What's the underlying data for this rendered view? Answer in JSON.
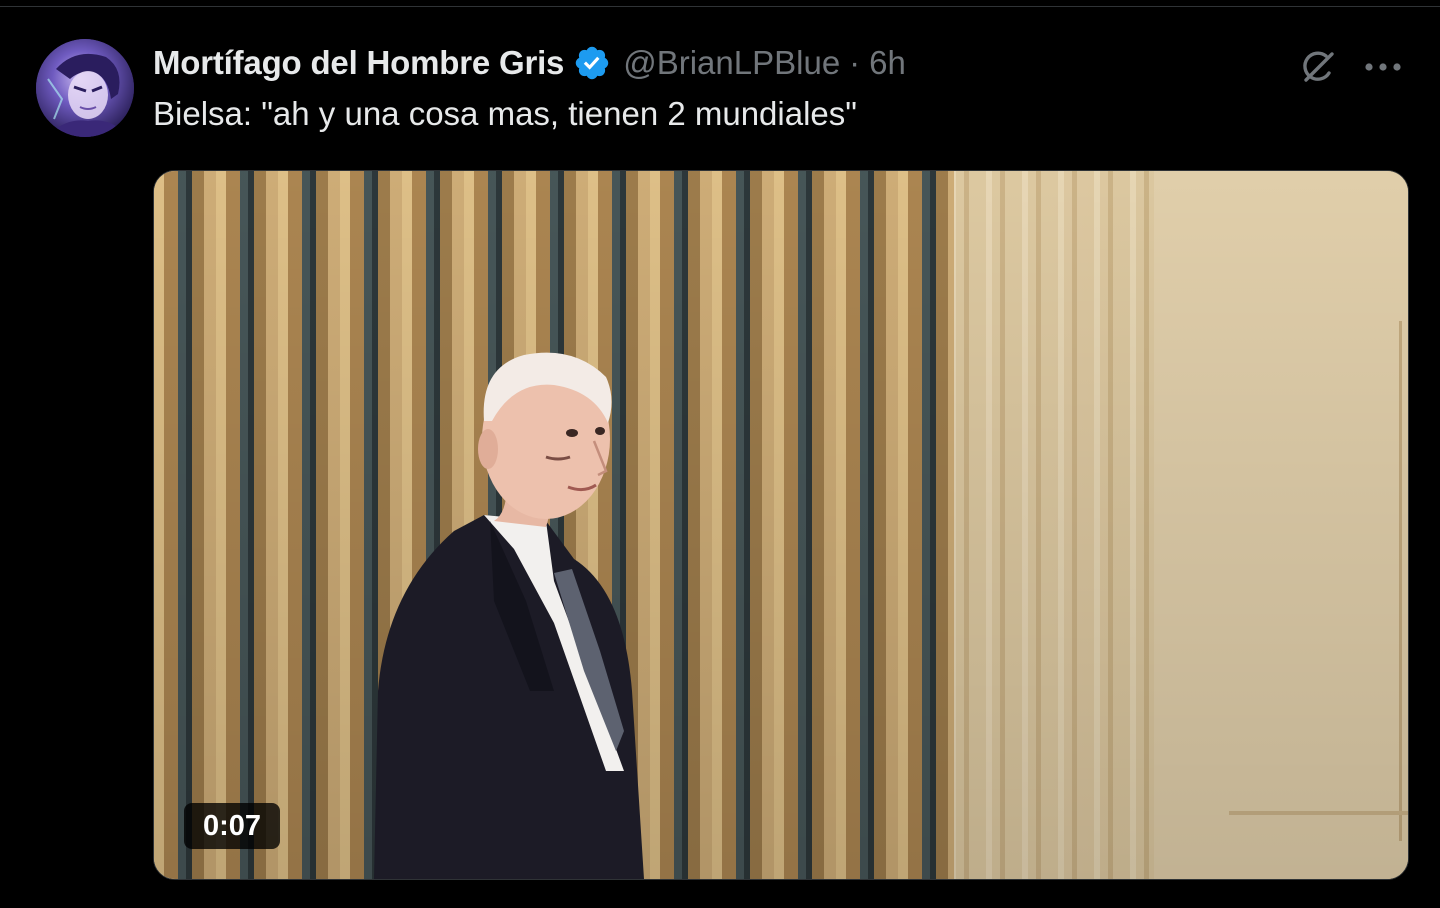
{
  "tweet": {
    "display_name": "Mortífago del Hombre Gris",
    "verified": true,
    "handle": "@BrianLPBlue",
    "separator": "·",
    "time": "6h",
    "text": "Bielsa: \"ah y una cosa mas, tienen 2 mundiales\"",
    "media": {
      "type": "video",
      "duration": "0:07"
    }
  },
  "icons": {
    "verified": "verified-badge-icon",
    "grok": "grok-icon",
    "more": "more-horizontal-icon"
  },
  "colors": {
    "background": "#000000",
    "text_primary": "#e7e9ea",
    "text_secondary": "#71767b",
    "verified_blue": "#1d9bf0"
  }
}
